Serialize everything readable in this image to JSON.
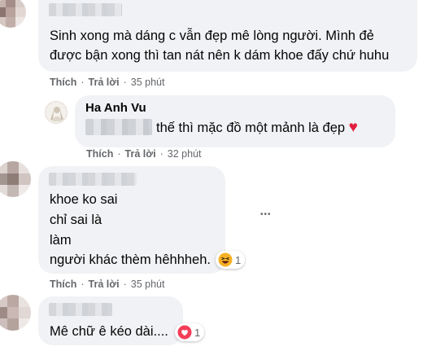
{
  "comments": [
    {
      "lines": [
        "Sinh xong mà dáng c vẫn đẹp mê lòng người. Mình đẻ",
        "được bận xong thì tan nát nên k dám khoe đấy chứ huhu"
      ],
      "actions": {
        "like": "Thích",
        "reply": "Trả lời",
        "time": "35 phút"
      }
    },
    {
      "author": "Ha Anh Vu",
      "text": "thế thì mặc đồ một mảnh là đẹp ♥",
      "actions": {
        "like": "Thích",
        "reply": "Trả lời",
        "time": "32 phút"
      }
    },
    {
      "lines": [
        "khoe ko sai",
        "chỉ sai là",
        "làm",
        "người khác thèm hêhhheh."
      ],
      "reaction": {
        "type": "haha",
        "count": "1"
      },
      "actions": {
        "like": "Thích",
        "reply": "Trả lời",
        "time": "35 phút"
      }
    },
    {
      "lines": [
        "Mê chữ ê kéo dài...."
      ],
      "reaction": {
        "type": "love",
        "count": "1"
      }
    }
  ],
  "more_options": "•••",
  "separator": "·",
  "colors": {
    "bubble": "#f0f2f5",
    "meta": "#65676b",
    "text": "#050505",
    "heart": "#e41e3f",
    "haha": "#f7b125"
  }
}
